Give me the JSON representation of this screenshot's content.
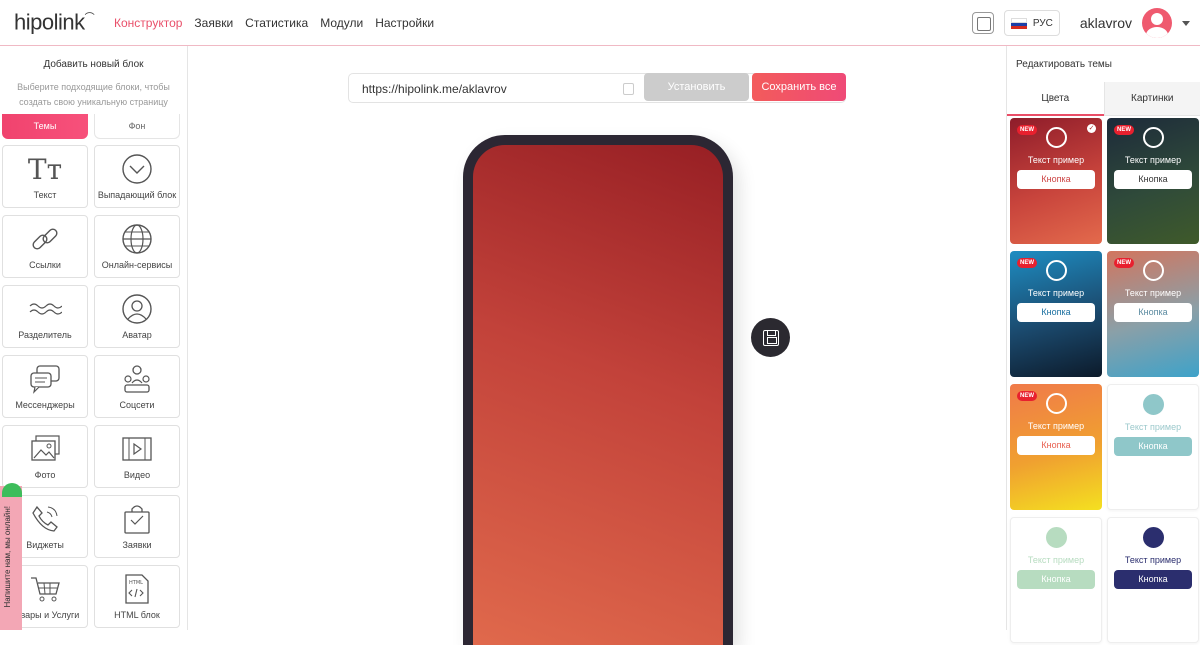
{
  "header": {
    "logo": "hipolink",
    "nav": [
      "Конструктор",
      "Заявки",
      "Статистика",
      "Модули",
      "Настройки"
    ],
    "language": "РУС",
    "username": "aklavrov"
  },
  "left_panel": {
    "title": "Добавить новый блок",
    "subtitle": "Выберите подходящие блоки, чтобы создать свою уникальную страницу",
    "tab_themes": "Темы",
    "tab_background": "Фон",
    "blocks": [
      {
        "label": "Текст",
        "icon": "text-icon"
      },
      {
        "label": "Выпадающий блок",
        "icon": "dropdown-icon"
      },
      {
        "label": "Ссылки",
        "icon": "link-icon"
      },
      {
        "label": "Онлайн-сервисы",
        "icon": "globe-icon"
      },
      {
        "label": "Разделитель",
        "icon": "divider-icon"
      },
      {
        "label": "Аватар",
        "icon": "avatar-icon"
      },
      {
        "label": "Мессенджеры",
        "icon": "messengers-icon"
      },
      {
        "label": "Соцсети",
        "icon": "social-icon"
      },
      {
        "label": "Фото",
        "icon": "photo-icon"
      },
      {
        "label": "Видео",
        "icon": "video-icon"
      },
      {
        "label": "Виджеты",
        "icon": "phone-icon"
      },
      {
        "label": "Заявки",
        "icon": "bag-icon"
      },
      {
        "label": "Товары и Услуги",
        "icon": "cart-icon"
      },
      {
        "label": "HTML блок",
        "icon": "html-icon"
      }
    ],
    "chat_tab": "Напишите нам, мы онлайн!"
  },
  "editor": {
    "url": "https://hipolink.me/aklavrov",
    "install_button": "Установить",
    "save_all_button": "Сохранить все"
  },
  "right_panel": {
    "title": "Редактировать темы",
    "tabs": [
      "Цвета",
      "Картинки"
    ],
    "themes": [
      {
        "new": true,
        "selected": true,
        "text": "Текст пример",
        "button": "Кнопка",
        "bg": "linear-gradient(160deg,#8e1c2a,#c8443c 55%,#e36a4c)",
        "fg": "#fff",
        "btn_bg": "#fff",
        "btn_fg": "#c44"
      },
      {
        "new": true,
        "selected": false,
        "text": "Текст пример",
        "button": "Кнопка",
        "bg": "linear-gradient(160deg,#1d2a3a,#2f4a3a 55%,#3f5a2a)",
        "fg": "#fff",
        "btn_bg": "#fff",
        "btn_fg": "#333"
      },
      {
        "new": true,
        "selected": false,
        "text": "Текст пример",
        "button": "Кнопка",
        "bg": "linear-gradient(165deg,#1e8dc2,#1b4a6e 55%,#0c1a2a)",
        "fg": "#fff",
        "btn_bg": "#fff",
        "btn_fg": "#1a6fa0"
      },
      {
        "new": true,
        "selected": false,
        "text": "Текст пример",
        "button": "Кнопка",
        "bg": "linear-gradient(165deg,#d2755e,#8aa0a8 55%,#3ea2c9)",
        "fg": "#fff",
        "btn_bg": "#fff",
        "btn_fg": "#5a8aa0"
      },
      {
        "new": true,
        "selected": false,
        "text": "Текст пример",
        "button": "Кнопка",
        "bg": "linear-gradient(165deg,#f07a4a,#f0a030 55%,#f4e020)",
        "fg": "#fff",
        "btn_bg": "#fff",
        "btn_fg": "#e86050"
      },
      {
        "new": false,
        "selected": false,
        "text": "Текст пример",
        "button": "Кнопка",
        "bg": "#ffffff",
        "fg": "#9cc9cc",
        "btn_bg": "#8fc7c9",
        "btn_fg": "#fff",
        "circle": "#8fc7c9"
      },
      {
        "new": false,
        "selected": false,
        "text": "Текст пример",
        "button": "Кнопка",
        "bg": "#ffffff",
        "fg": "#b7dcc0",
        "btn_bg": "#b7dcc0",
        "btn_fg": "#fff",
        "circle": "#b7dcc0"
      },
      {
        "new": false,
        "selected": false,
        "text": "Текст пример",
        "button": "Кнопка",
        "bg": "#ffffff",
        "fg": "#2b2e6e",
        "btn_bg": "#2b2e6e",
        "btn_fg": "#fff",
        "circle": "#2b2e6e"
      }
    ],
    "new_badge": "NEW"
  }
}
